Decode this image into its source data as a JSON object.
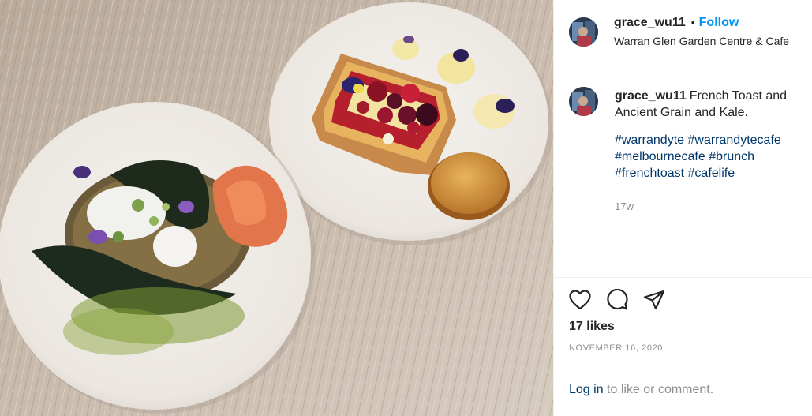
{
  "post": {
    "image_alt": "French toast with berries and a hash brown on one plate, ancient grains with kale, poached egg and smoked salmon on another"
  },
  "header": {
    "username": "grace_wu11",
    "separator": "•",
    "follow_label": "Follow",
    "location": "Warran Glen Garden Centre & Cafe"
  },
  "caption": {
    "username": "grace_wu11",
    "text": "French Toast and Ancient Grain and Kale.",
    "hashtags": [
      "#warrandyte",
      "#warrandytecafe",
      "#melbournecafe",
      "#brunch",
      "#frenchtoast",
      "#cafelife"
    ],
    "age": "17w"
  },
  "actions": {
    "like_icon": "heart-icon",
    "comment_icon": "comment-icon",
    "share_icon": "share-icon"
  },
  "likes": "17 likes",
  "date": "NOVEMBER 16, 2020",
  "login": {
    "link": "Log in",
    "rest": " to like or comment."
  },
  "colors": {
    "follow_blue": "#0095f6",
    "hashtag_blue": "#00376b",
    "muted_gray": "#8e8e8e",
    "divider": "#efefef"
  }
}
